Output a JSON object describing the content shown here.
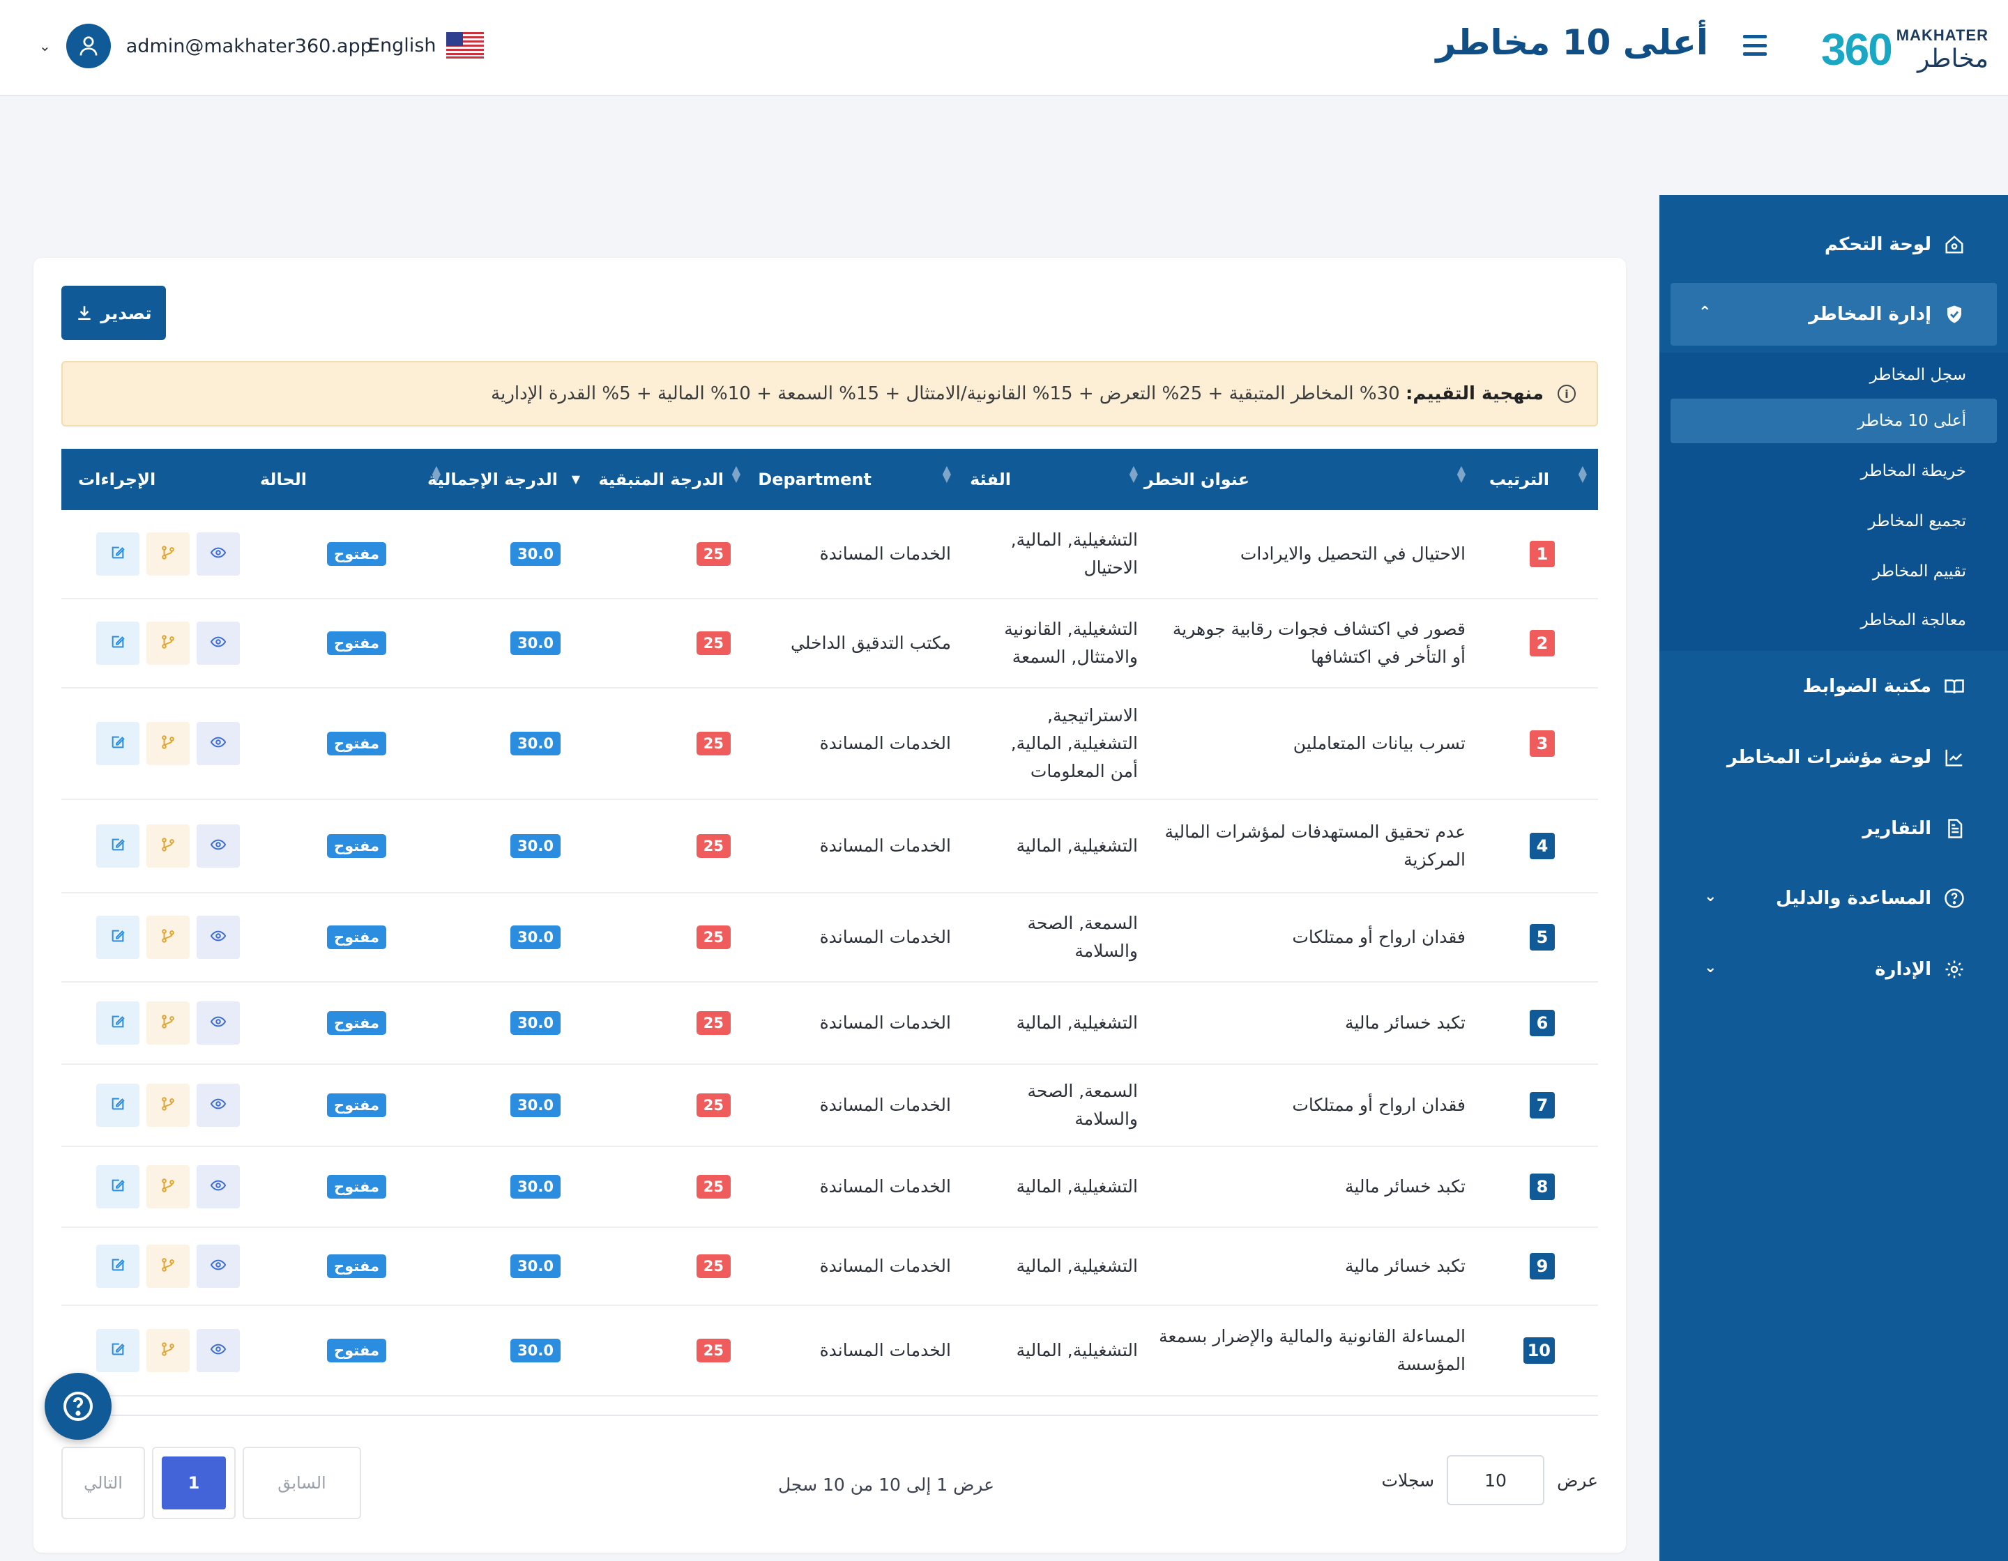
{
  "header": {
    "logo_number": "360",
    "logo_en": "MAKHATER",
    "logo_ar": "مخاطر",
    "title": "أعلى 10 مخاطر",
    "language": "English",
    "user_email": "admin@makhater360.app"
  },
  "sidebar": {
    "items": [
      {
        "label": "لوحة التحكم",
        "icon": "home-icon"
      },
      {
        "label": "إدارة المخاطر",
        "icon": "shield-icon"
      },
      {
        "label": "مكتبة الضوابط",
        "icon": "book-icon"
      },
      {
        "label": "لوحة مؤشرات المخاطر",
        "icon": "chart-line-icon"
      },
      {
        "label": "التقارير",
        "icon": "document-icon"
      },
      {
        "label": "المساعدة والدليل",
        "icon": "help-circle-icon"
      },
      {
        "label": "الإدارة",
        "icon": "gear-icon"
      }
    ],
    "subitems": [
      {
        "label": "سجل المخاطر"
      },
      {
        "label": "أعلى 10 مخاطر"
      },
      {
        "label": "خريطة المخاطر"
      },
      {
        "label": "تجميع المخاطر"
      },
      {
        "label": "تقييم المخاطر"
      },
      {
        "label": "معالجة المخاطر"
      }
    ]
  },
  "toolbar": {
    "export_label": "تصدير"
  },
  "alert": {
    "title": "منهجية التقييم:",
    "text": "30% المخاطر المتبقية + 25% التعرض + 15% القانونية/الامتثال + 15% السمعة + 10% المالية + 5% القدرة الإدارية"
  },
  "table": {
    "headers": {
      "rank": "الترتيب",
      "title": "عنوان الخطر",
      "category": "الفئة",
      "department": "Department",
      "residual": "الدرجة المتبقية",
      "total": "الدرجة الإجمالية",
      "status": "الحالة",
      "actions": "الإجراءات"
    },
    "rows": [
      {
        "rank": "1",
        "title": "الاحتيال في التحصيل والايرادات",
        "category": "التشغيلية, المالية, الاحتيال",
        "department": "الخدمات المساندة",
        "residual": "25",
        "total": "30.0",
        "status": "مفتوح"
      },
      {
        "rank": "2",
        "title": "قصور في اكتشاف فجوات رقابية جوهرية أو التأخر في اكتشافها",
        "category": "التشغيلية, القانونية والامتثال, السمعة",
        "department": "مكتب التدقيق الداخلي",
        "residual": "25",
        "total": "30.0",
        "status": "مفتوح"
      },
      {
        "rank": "3",
        "title": "تسرب بيانات المتعاملين",
        "category": "الاستراتيجية, التشغيلية, المالية, أمن المعلومات",
        "department": "الخدمات المساندة",
        "residual": "25",
        "total": "30.0",
        "status": "مفتوح"
      },
      {
        "rank": "4",
        "title": "عدم تحقيق المستهدفات لمؤشرات المالية المركزية",
        "category": "التشغيلية, المالية",
        "department": "الخدمات المساندة",
        "residual": "25",
        "total": "30.0",
        "status": "مفتوح"
      },
      {
        "rank": "5",
        "title": "فقدان ارواح أو ممتلكات",
        "category": "السمعة, الصحة والسلامة",
        "department": "الخدمات المساندة",
        "residual": "25",
        "total": "30.0",
        "status": "مفتوح"
      },
      {
        "rank": "6",
        "title": "تكبد خسائر مالية",
        "category": "التشغيلية, المالية",
        "department": "الخدمات المساندة",
        "residual": "25",
        "total": "30.0",
        "status": "مفتوح"
      },
      {
        "rank": "7",
        "title": "فقدان ارواح أو ممتلكات",
        "category": "السمعة, الصحة والسلامة",
        "department": "الخدمات المساندة",
        "residual": "25",
        "total": "30.0",
        "status": "مفتوح"
      },
      {
        "rank": "8",
        "title": "تكبد خسائر مالية",
        "category": "التشغيلية, المالية",
        "department": "الخدمات المساندة",
        "residual": "25",
        "total": "30.0",
        "status": "مفتوح"
      },
      {
        "rank": "9",
        "title": "تكبد خسائر مالية",
        "category": "التشغيلية, المالية",
        "department": "الخدمات المساندة",
        "residual": "25",
        "total": "30.0",
        "status": "مفتوح"
      },
      {
        "rank": "10",
        "title": "المساءلة القانونية والمالية والإضرار بسمعة المؤسسة",
        "category": "التشغيلية, المالية",
        "department": "الخدمات المساندة",
        "residual": "25",
        "total": "30.0",
        "status": "مفتوح"
      }
    ]
  },
  "footer": {
    "show_label": "عرض",
    "page_length": "10",
    "records_label": "سجلات",
    "info": "عرض 1 إلى 10 من 10 سجل",
    "prev_label": "السابق",
    "current_page": "1",
    "next_label": "التالي"
  },
  "colors": {
    "primary": "#0f5a97",
    "rank_high": "#f05b5b",
    "rank_normal": "#0f5a97",
    "score_badge": "#2b8de0",
    "status_badge": "#2b8de0",
    "alert_bg": "#fcefd6"
  }
}
